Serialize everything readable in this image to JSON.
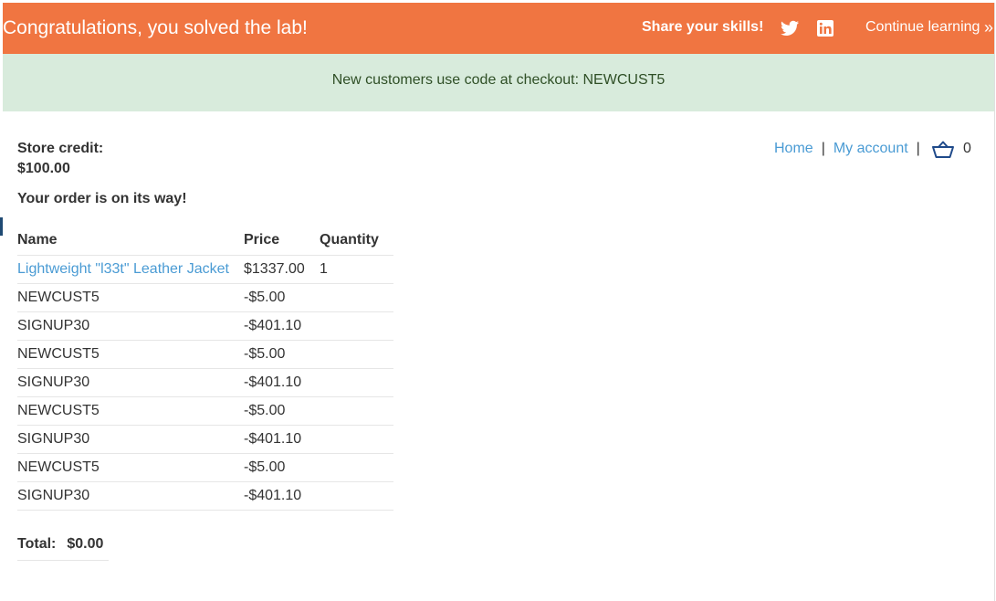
{
  "banner": {
    "title": "Congratulations, you solved the lab!",
    "share_label": "Share your skills!",
    "continue_label": "Continue learning",
    "continue_chevron": "»",
    "background": "#f07541"
  },
  "notice": {
    "text": "New customers use code at checkout: NEWCUST5",
    "background": "#d8ebdc"
  },
  "nav": {
    "home": "Home",
    "separator": "|",
    "my_account": "My account",
    "cart_count": "0"
  },
  "account": {
    "credit_label": "Store credit:",
    "credit_value": "$100.00",
    "order_message": "Your order is on its way!"
  },
  "order": {
    "headers": [
      "Name",
      "Price",
      "Quantity"
    ],
    "rows": [
      {
        "name": "Lightweight \"l33t\" Leather Jacket",
        "price": "$1337.00",
        "quantity": "1",
        "link": true
      },
      {
        "name": "NEWCUST5",
        "price": "-$5.00",
        "quantity": ""
      },
      {
        "name": "SIGNUP30",
        "price": "-$401.10",
        "quantity": ""
      },
      {
        "name": "NEWCUST5",
        "price": "-$5.00",
        "quantity": ""
      },
      {
        "name": "SIGNUP30",
        "price": "-$401.10",
        "quantity": ""
      },
      {
        "name": "NEWCUST5",
        "price": "-$5.00",
        "quantity": ""
      },
      {
        "name": "SIGNUP30",
        "price": "-$401.10",
        "quantity": ""
      },
      {
        "name": "NEWCUST5",
        "price": "-$5.00",
        "quantity": ""
      },
      {
        "name": "SIGNUP30",
        "price": "-$401.10",
        "quantity": ""
      }
    ],
    "total_label": "Total:",
    "total_value": "$0.00"
  },
  "icons": {
    "twitter": "twitter-icon",
    "linkedin": "linkedin-icon",
    "cart": "cart-icon"
  },
  "colors": {
    "link": "#4a9bd4",
    "notice_text": "#2f4f26"
  }
}
